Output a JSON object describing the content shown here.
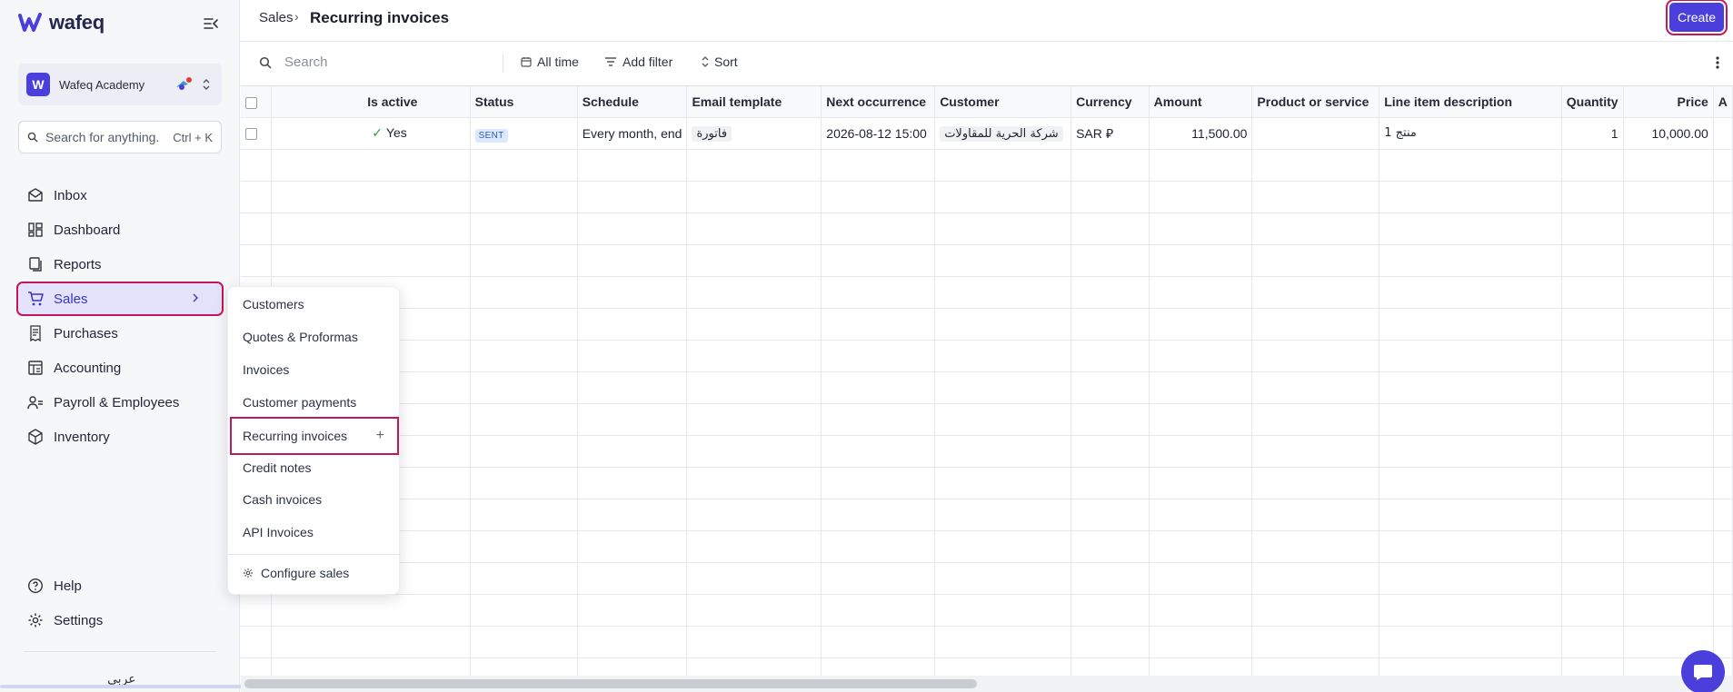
{
  "brand": {
    "name": "wafeq",
    "accent": "#4b3fdc",
    "highlight": "#c2185b"
  },
  "org": {
    "name": "Wafeq Academy",
    "avatar_letter": "W"
  },
  "search": {
    "placeholder": "Search for anything...",
    "shortcut": "Ctrl + K"
  },
  "nav": {
    "items": [
      {
        "label": "Inbox",
        "icon": "inbox-icon"
      },
      {
        "label": "Dashboard",
        "icon": "dashboard-icon"
      },
      {
        "label": "Reports",
        "icon": "reports-icon"
      },
      {
        "label": "Sales",
        "icon": "cart-icon",
        "active": true
      },
      {
        "label": "Purchases",
        "icon": "receipt-icon"
      },
      {
        "label": "Accounting",
        "icon": "ledger-icon"
      },
      {
        "label": "Payroll & Employees",
        "icon": "people-icon"
      },
      {
        "label": "Inventory",
        "icon": "box-icon"
      }
    ],
    "bottom": [
      {
        "label": "Help",
        "icon": "help-icon"
      },
      {
        "label": "Settings",
        "icon": "gear-icon"
      }
    ],
    "language": "عربي"
  },
  "submenu": {
    "items": [
      "Customers",
      "Quotes & Proformas",
      "Invoices",
      "Customer payments",
      "Recurring invoices",
      "Credit notes",
      "Cash invoices",
      "API Invoices"
    ],
    "highlighted": "Recurring invoices",
    "plus": "+",
    "configure": "Configure sales"
  },
  "header": {
    "breadcrumb_parent": "Sales",
    "breadcrumb_sep": "›",
    "title": "Recurring invoices",
    "create_label": "Create"
  },
  "toolbar": {
    "search_placeholder": "Search",
    "date_filter": "All time",
    "add_filter": "Add filter",
    "sort": "Sort"
  },
  "table": {
    "columns": [
      "Is active",
      "Status",
      "Schedule",
      "Email template",
      "Next occurrence",
      "Customer",
      "Currency",
      "Amount",
      "Product or service",
      "Line item description",
      "Quantity",
      "Price",
      "A"
    ],
    "rows": [
      {
        "is_active": "Yes",
        "status": "SENT",
        "schedule": "Every month, end",
        "email_template": "فاتورة",
        "next_occurrence": "2026-08-12 15:00",
        "customer": "شركة الحرية للمقاولات",
        "currency": "SAR",
        "currency_symbol": "⃁",
        "amount": "11,500.00",
        "product": "",
        "description": "منتج 1",
        "quantity": "1",
        "price": "10,000.00"
      }
    ]
  }
}
